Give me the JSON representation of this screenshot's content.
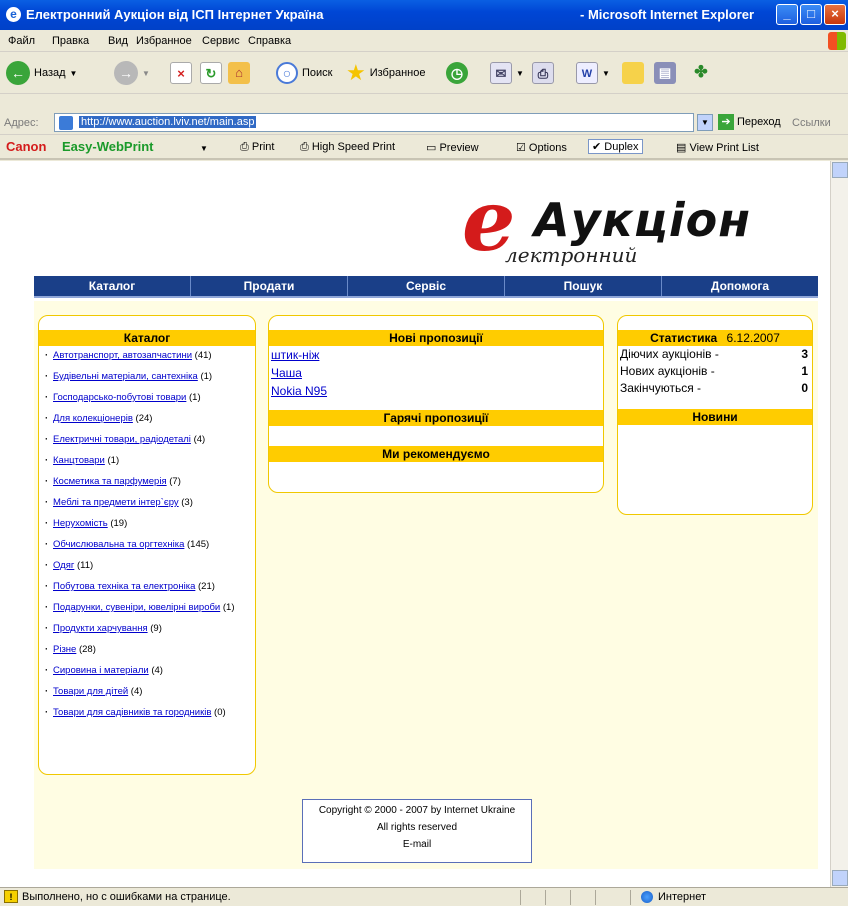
{
  "window": {
    "title": "Електронний Аукціон від ІСП Інтернет Україна",
    "app_name": "- Microsoft Internet Explorer",
    "min_glyph": "_",
    "max_glyph": "□",
    "close_glyph": "×"
  },
  "menu": [
    "Файл",
    "Правка",
    "Вид",
    "Избранное",
    "Сервис",
    "Справка"
  ],
  "toolbar": {
    "back": "Назад",
    "search": "Поиск",
    "favorites": "Избранное"
  },
  "address": {
    "label": "Адрес:",
    "url": "http://www.auction.lviv.net/main.asp",
    "go": "Переход",
    "links": "Ссылки"
  },
  "canon": {
    "brand": "Canon",
    "product": "Easy-WebPrint",
    "print": "Print",
    "high_speed": "High Speed Print",
    "preview": "Preview",
    "options": "Options",
    "duplex": "Duplex",
    "view_list": "View Print List"
  },
  "logo": {
    "letter": "е",
    "word": "Аукціон",
    "sub": "лектронний"
  },
  "nav": [
    "Каталог",
    "Продати",
    "Сервіс",
    "Пошук",
    "Допомога"
  ],
  "catalog": {
    "title": "Каталог",
    "items": [
      {
        "label": "Автотранспорт, автозапчастини",
        "count": "(41)"
      },
      {
        "label": "Будівельні матеріали, сантехніка",
        "count": "(1)"
      },
      {
        "label": "Господарсько-побутові товари",
        "count": "(1)"
      },
      {
        "label": "Для колекціонерів",
        "count": "(24)"
      },
      {
        "label": "Електричні товари, радіодеталі",
        "count": "(4)"
      },
      {
        "label": "Канцтовари",
        "count": "(1)"
      },
      {
        "label": "Косметика та парфумерія",
        "count": "(7)"
      },
      {
        "label": "Меблі та предмети інтер`єру",
        "count": "(3)"
      },
      {
        "label": "Нерухомість",
        "count": "(19)"
      },
      {
        "label": "Обчислювальна та оргтехніка",
        "count": "(145)"
      },
      {
        "label": "Одяг",
        "count": "(11)"
      },
      {
        "label": "Побутова техніка та електроніка",
        "count": "(21)"
      },
      {
        "label": "Подарунки, сувеніри, ювелірні вироби",
        "count": "(1)"
      },
      {
        "label": "Продукти харчування",
        "count": "(9)"
      },
      {
        "label": "Різне",
        "count": "(28)"
      },
      {
        "label": "Сировина і матеріали",
        "count": "(4)"
      },
      {
        "label": "Товари для дітей",
        "count": "(4)"
      },
      {
        "label": "Товари для садівників та городників",
        "count": "(0)"
      }
    ]
  },
  "new_offers": {
    "title": "Нові пропозиції",
    "items": [
      "штик-ніж",
      "Чаша",
      "Nokia N95"
    ]
  },
  "hot_offers": {
    "title": "Гарячі пропозиції"
  },
  "recommend": {
    "title": "Ми рекомендуємо"
  },
  "stats": {
    "title": "Статистика",
    "date": "6.12.2007",
    "rows": [
      {
        "label": "Діючих аукціонів -",
        "value": "3"
      },
      {
        "label": "Нових аукціонів -",
        "value": "1"
      },
      {
        "label": "Закінчуються -",
        "value": "0"
      }
    ]
  },
  "news": {
    "title": "Новини"
  },
  "footer": {
    "copyright": "Copyright © 2000 - 2007 by Internet Ukraine",
    "rights": "All rights reserved",
    "email": "E-mail"
  },
  "status": {
    "message": "Выполнено, но с ошибками на странице.",
    "zone": "Интернет"
  },
  "colors": {
    "nav_bg": "#1a3f88",
    "box_header": "#ffcc00",
    "logo_red": "#d41b1b",
    "link": "#0000cc"
  }
}
